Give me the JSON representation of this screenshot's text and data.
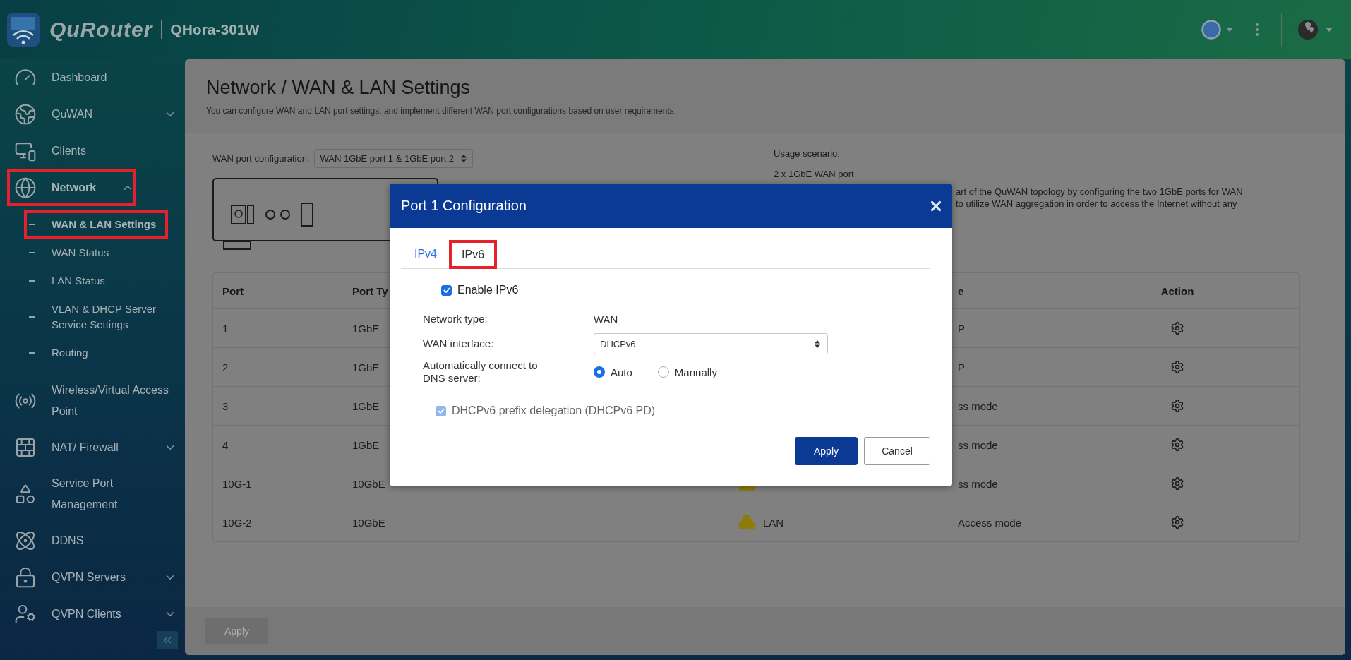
{
  "header": {
    "logo_text": "QuRouter",
    "device_name": "QHora-301W"
  },
  "sidebar": {
    "items": [
      {
        "label": "Dashboard",
        "kind": "link",
        "selected": false,
        "highlighted": false
      },
      {
        "label": "QuWAN",
        "kind": "group",
        "expanded": false,
        "selected": false,
        "highlighted": false
      },
      {
        "label": "Clients",
        "kind": "link",
        "selected": false,
        "highlighted": false
      },
      {
        "label": "Network",
        "kind": "group",
        "expanded": true,
        "selected": true,
        "highlighted": true,
        "children": [
          {
            "label": "WAN & LAN Settings",
            "selected": true,
            "highlighted": true
          },
          {
            "label": "WAN Status",
            "selected": false,
            "highlighted": false
          },
          {
            "label": "LAN Status",
            "selected": false,
            "highlighted": false
          },
          {
            "label": "VLAN & DHCP Server Service Settings",
            "selected": false,
            "highlighted": false
          },
          {
            "label": "Routing",
            "selected": false,
            "highlighted": false
          }
        ]
      },
      {
        "label": "Wireless/Virtual Access Point",
        "kind": "link",
        "selected": false,
        "highlighted": false
      },
      {
        "label": "NAT/ Firewall",
        "kind": "group",
        "expanded": false,
        "selected": false,
        "highlighted": false
      },
      {
        "label": "Service Port Management",
        "kind": "link",
        "selected": false,
        "highlighted": false
      },
      {
        "label": "DDNS",
        "kind": "link",
        "selected": false,
        "highlighted": false
      },
      {
        "label": "QVPN Servers",
        "kind": "group",
        "expanded": false,
        "selected": false,
        "highlighted": false
      },
      {
        "label": "QVPN Clients",
        "kind": "group",
        "expanded": false,
        "selected": false,
        "highlighted": false
      }
    ]
  },
  "page": {
    "title": "Network / WAN & LAN Settings",
    "subtitle": "You can configure WAN and LAN port settings, and implement different WAN port configurations based on user requirements.",
    "wan_port_configuration": {
      "label": "WAN port configuration:",
      "value": "WAN 1GbE port 1 & 1GbE port 2"
    },
    "usage": {
      "title": "Usage scenario:",
      "scenario": "2 x 1GbE WAN port",
      "description_lines": [
        "art of the QuWAN topology by configuring the two 1GbE ports for WAN",
        "to utilize WAN aggregation in order to access the Internet without any"
      ]
    },
    "table": {
      "columns": [
        "Port",
        "Port Ty",
        "e",
        "Action"
      ],
      "rows": [
        {
          "port": "1",
          "port_type": "1GbE",
          "mode": "P"
        },
        {
          "port": "2",
          "port_type": "1GbE",
          "mode": "P"
        },
        {
          "port": "3",
          "port_type": "1GbE",
          "mode": "ss mode"
        },
        {
          "port": "4",
          "port_type": "1GbE",
          "mode": "ss mode"
        },
        {
          "port": "10G-1",
          "port_type": "10GbE",
          "kind": "lan",
          "mode": "ss mode"
        },
        {
          "port": "10G-2",
          "port_type": "10GbE",
          "kind": "lan",
          "network": "LAN",
          "mode": "Access mode"
        }
      ]
    },
    "apply_button": {
      "label": "Apply",
      "disabled": true
    }
  },
  "dialog": {
    "title": "Port 1 Configuration",
    "tabs": [
      {
        "label": "IPv4",
        "selected": false,
        "highlighted": false
      },
      {
        "label": "IPv6",
        "selected": true,
        "highlighted": true
      }
    ],
    "enable_ipv6": {
      "label": "Enable IPv6",
      "checked": true
    },
    "network_type": {
      "label": "Network type:",
      "value": "WAN"
    },
    "wan_interface": {
      "label": "WAN interface:",
      "value": "DHCPv6"
    },
    "dns": {
      "label": "Automatically connect to DNS server:",
      "options": [
        {
          "label": "Auto",
          "selected": true
        },
        {
          "label": "Manually",
          "selected": false
        }
      ]
    },
    "prefix_delegation": {
      "label": "DHCPv6 prefix delegation (DHCPv6 PD)",
      "checked": true,
      "disabled": true
    },
    "buttons": [
      {
        "label": "Apply",
        "kind": "primary"
      },
      {
        "label": "Cancel",
        "kind": "secondary"
      }
    ]
  }
}
